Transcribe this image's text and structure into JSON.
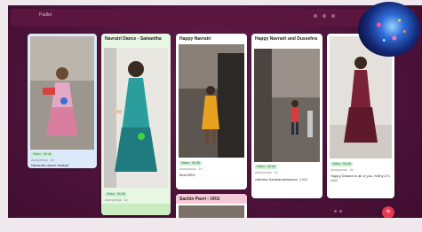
{
  "header": {
    "title": "Padlet"
  },
  "cards": [
    {
      "title": "",
      "badge": "Video · 00:46",
      "meta": "Anonymous · 1d",
      "caption": "Navaratri dance festival"
    },
    {
      "title": "Navratri Dance - Samantha",
      "badge": "Video · 00:46",
      "meta": "Anonymous · 1d",
      "caption": ""
    },
    {
      "title": "Happy Navratri",
      "badge": "Video · 00:46",
      "meta": "Anonymous · 1d",
      "caption": "Best BRO"
    },
    {
      "title": "Happy Navratri and Dussehra",
      "badge": "Video · 00:46",
      "meta": "Anonymous · 1d",
      "caption": "vidhvika Santhanakrishnan, 1 KG"
    },
    {
      "title": "",
      "badge": "Video · 00:46",
      "meta": "Anonymous · 1d",
      "caption": "Happy Dasara to all of you, Krithy A S, LKG"
    },
    {
      "title": "Sachin Pavri - UKG",
      "badge": "",
      "meta": "",
      "caption": ""
    }
  ],
  "fab": {
    "label": "+"
  },
  "colors": {
    "accent": "#e53952",
    "background": "#4c1239",
    "badge": "#ccefd2"
  }
}
